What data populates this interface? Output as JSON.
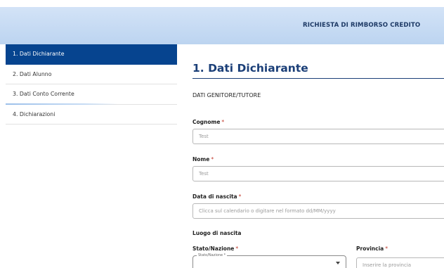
{
  "header": {
    "title": "RICHIESTA DI RIMBORSO CREDITO"
  },
  "sidebar": {
    "items": [
      {
        "label": "1. Dati Dichiarante",
        "active": true
      },
      {
        "label": "2. Dati Alunno"
      },
      {
        "label": "3. Dati Conto Corrente"
      },
      {
        "label": "4. Dichiarazioni"
      }
    ]
  },
  "main": {
    "section_title": "1. Dati Dichiarante",
    "group_title": "DATI GENITORE/TUTORE",
    "required_marker": "*",
    "fields": {
      "cognome": {
        "label": "Cognome",
        "value": "Test"
      },
      "nome": {
        "label": "Nome",
        "value": "Test"
      },
      "data_nascita": {
        "label": "Data di nascita",
        "placeholder": "Clicca sul calendario o digitare nel formato dd/MM/yyyy"
      },
      "luogo_nascita": {
        "label": "Luogo di nascita"
      },
      "stato": {
        "label": "Stato/Nazione",
        "float_label": "Stato/Nazione *"
      },
      "provincia": {
        "label": "Provincia",
        "placeholder": "Inserire la provincia"
      }
    }
  },
  "colors": {
    "accent": "#06448f",
    "header_bg": "#c8dcf4",
    "title_text": "#1b3f78",
    "required": "#c0392b"
  }
}
